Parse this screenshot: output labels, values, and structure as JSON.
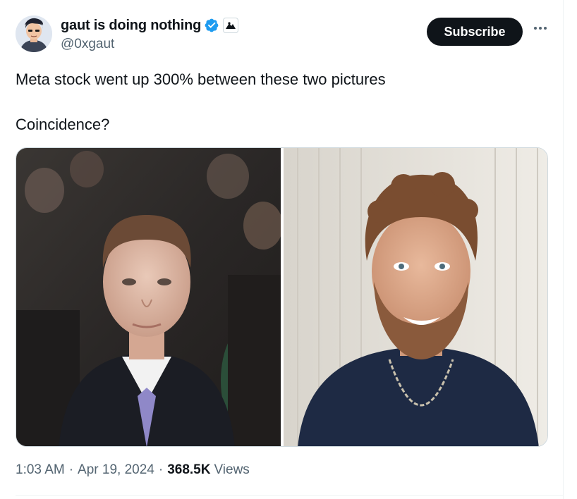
{
  "author": {
    "display_name": "gaut is doing nothing",
    "handle": "@0xgaut",
    "avatar": "cartoon-avatar",
    "verified_icon": "verified-badge-icon",
    "affiliation_icon": "affiliate-badge-icon"
  },
  "actions": {
    "subscribe_label": "Subscribe",
    "more_icon": "more-options-icon"
  },
  "tweet": {
    "line1": "Meta stock went up 300% between these two pictures",
    "line2": "Coincidence?"
  },
  "media": {
    "left_image": "photo-man-in-suit-at-hearing",
    "right_image": "photo-curly-haired-man-with-beard-and-chain"
  },
  "meta": {
    "time": "1:03 AM",
    "date": "Apr 19, 2024",
    "views_count": "368.5K",
    "views_label": "Views"
  },
  "colors": {
    "accent": "#1d9bf0",
    "text": "#0f1419",
    "secondary_text": "#536471",
    "button_bg": "#0f1419"
  }
}
